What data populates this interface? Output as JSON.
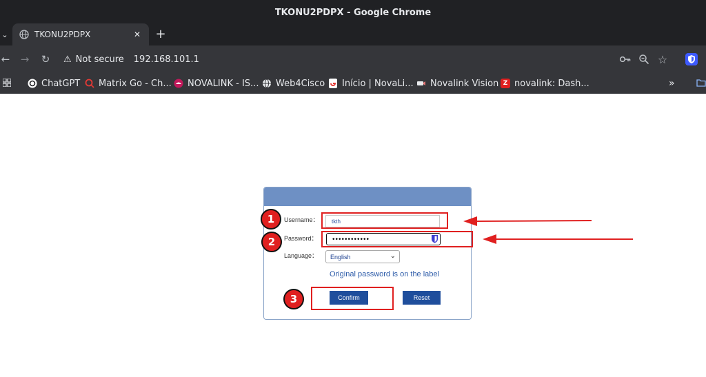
{
  "window": {
    "title": "TKONU2PDPX - Google Chrome"
  },
  "tab": {
    "title": "TKONU2PDPX"
  },
  "address_bar": {
    "security_label": "Not secure",
    "url": "192.168.101.1"
  },
  "bookmarks": [
    {
      "label": "ChatGPT",
      "color": "#202124",
      "glyph": ""
    },
    {
      "label": "Matrix Go - Ch...",
      "color": "#e53935",
      "glyph": ""
    },
    {
      "label": "NOVALINK - IS...",
      "color": "#c2185b",
      "glyph": ""
    },
    {
      "label": "Web4Cisco",
      "color": "#5f6368",
      "glyph": ""
    },
    {
      "label": "Início | NovaLi...",
      "color": "#ffffff",
      "glyph": ""
    },
    {
      "label": "Novalink Vision",
      "color": "#e57373",
      "glyph": ""
    },
    {
      "label": "novalink: Dash...",
      "color": "#e02020",
      "glyph": "Z"
    }
  ],
  "login": {
    "username_label": "Username：",
    "username_value": "tkth",
    "password_label": "Password：",
    "password_value": "••••••••••••",
    "language_label": "Language：",
    "language_value": "English",
    "hint": "Original password is on the label",
    "confirm_label": "Confirm",
    "reset_label": "Reset"
  },
  "annotations": {
    "step1": "1",
    "step2": "2",
    "step3": "3",
    "color": "#e02020"
  }
}
